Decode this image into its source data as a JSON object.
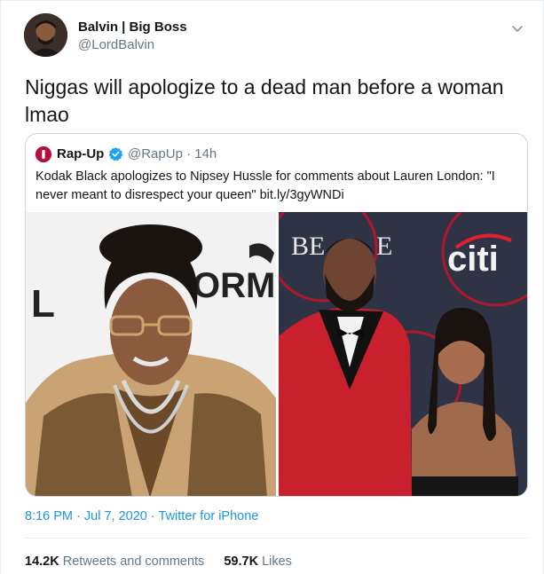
{
  "tweet": {
    "author": {
      "name": "Balvin | Big Boss",
      "handle": "@LordBalvin"
    },
    "text": "Niggas will apologize to a dead man before a woman lmao",
    "quoted": {
      "author_name": "Rap-Up",
      "author_handle": "@RapUp · 14h",
      "text": "Kodak Black apologizes to Nipsey Hussle for comments about Lauren London: \"I never meant to disrespect your queen\" bit.ly/3gyWNDi",
      "image_left_backdrop_text": [
        "L",
        "ORM"
      ],
      "image_right_backdrop_text": [
        "BE",
        "E",
        "citi"
      ]
    },
    "meta": {
      "time": "8:16 PM",
      "separator": "·",
      "date": "Jul 7, 2020",
      "source": "Twitter for iPhone"
    },
    "stats": {
      "retweets_count": "14.2K",
      "retweets_label": "Retweets and comments",
      "likes_count": "59.7K",
      "likes_label": "Likes"
    },
    "icons": {
      "caret": "chevron-down-icon",
      "verified": "verified-badge-icon"
    },
    "colors": {
      "link": "#1b95e0",
      "secondary_text": "#657786",
      "verified": "#1da1f2",
      "border": "#ccd6dd"
    }
  }
}
